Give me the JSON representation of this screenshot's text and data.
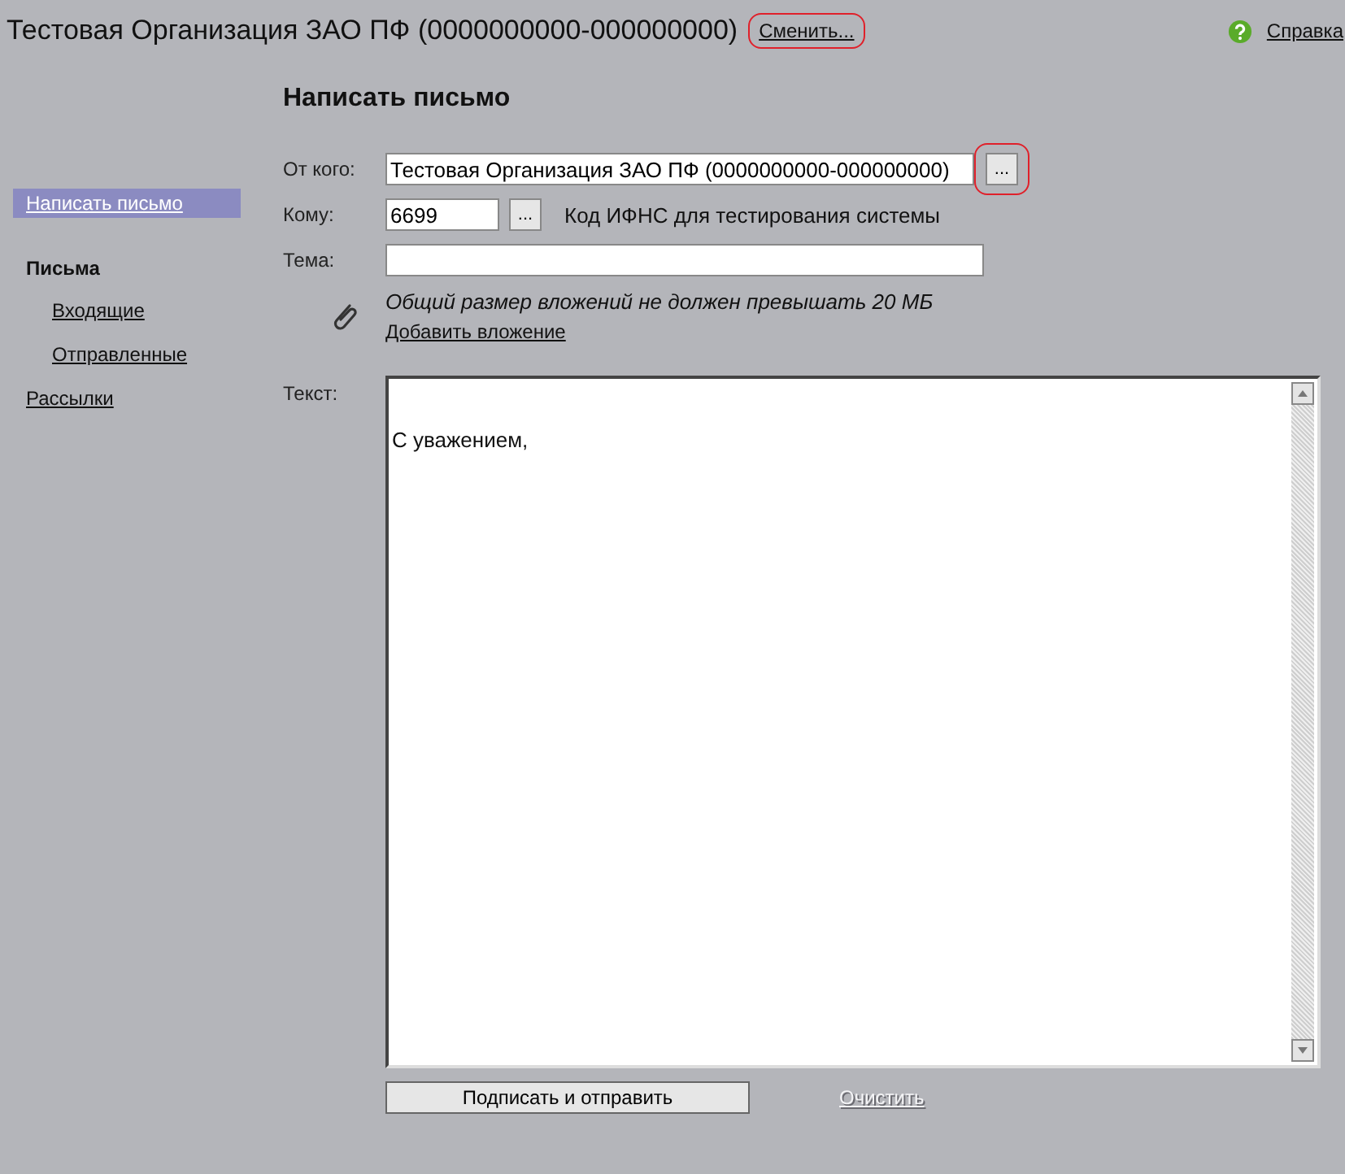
{
  "header": {
    "title": "Тестовая Организация ЗАО ПФ (0000000000-000000000)",
    "change_link": {
      "label": "Сменить...",
      "highlighted": true
    },
    "help_link": "Справка"
  },
  "sidebar": {
    "items": [
      {
        "label": "Написать письмо",
        "kind": "link",
        "selected": true
      },
      {
        "label": "Письма",
        "kind": "heading",
        "children": [
          {
            "label": "Входящие",
            "kind": "link",
            "selected": false
          },
          {
            "label": "Отправленные",
            "kind": "link",
            "selected": false
          }
        ]
      },
      {
        "label": "Рассылки",
        "kind": "link",
        "selected": false
      }
    ]
  },
  "form": {
    "title": "Написать письмо",
    "from": {
      "label": "От кого:",
      "value": "Тестовая Организация ЗАО ПФ (0000000000-000000000)",
      "browse_button": {
        "label": "...",
        "highlighted": true
      }
    },
    "to": {
      "label": "Кому:",
      "value": "6699",
      "browse_button": {
        "label": "..."
      },
      "note": "Код ИФНС для тестирования системы"
    },
    "subject": {
      "label": "Тема:"
    },
    "attachments": {
      "note": "Общий размер вложений не должен превышать 20 МБ",
      "link": "Добавить вложение"
    },
    "text": {
      "label": "Текст:",
      "value": "\n\nС уважением,"
    },
    "submit_button": "Подписать и отправить",
    "clear_link": {
      "label": "Очистить",
      "disabled": true
    }
  }
}
